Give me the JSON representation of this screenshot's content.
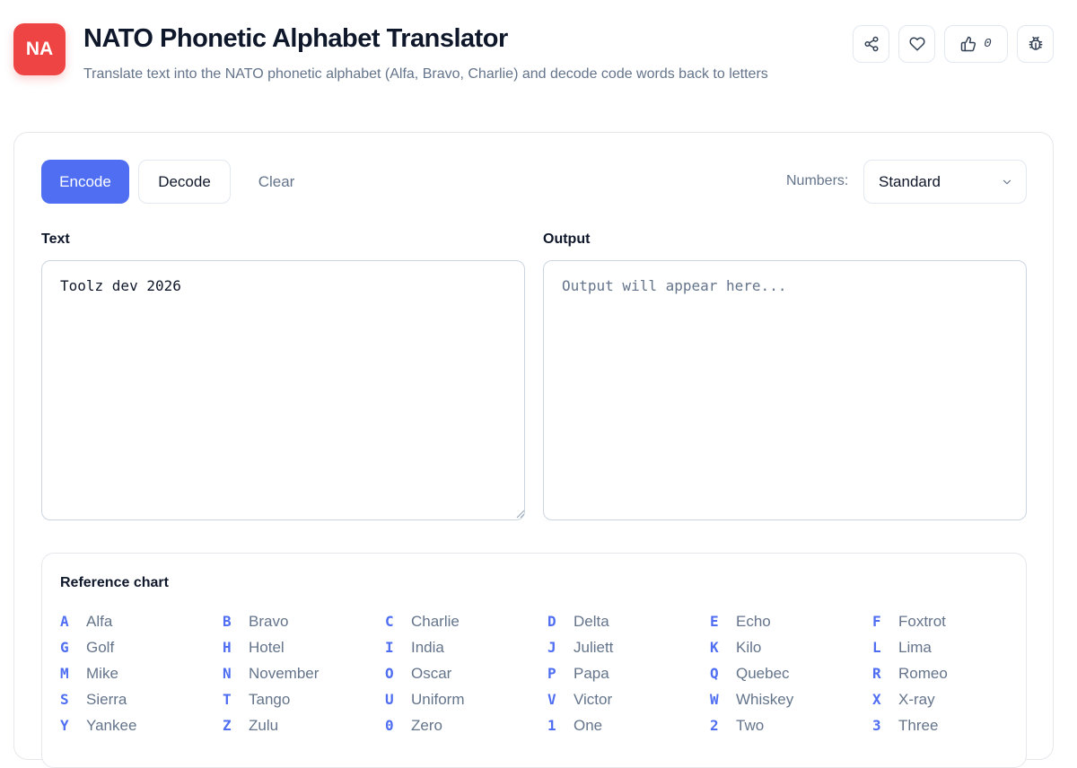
{
  "app": {
    "logo_text": "NA",
    "title": "NATO Phonetic Alphabet Translator",
    "subtitle": "Translate text into the NATO phonetic alphabet (Alfa, Bravo, Charlie) and decode code words back to letters"
  },
  "header_actions": {
    "like_count": "0"
  },
  "toolbar": {
    "encode_label": "Encode",
    "decode_label": "Decode",
    "clear_label": "Clear",
    "numbers_label": "Numbers:",
    "numbers_value": "Standard"
  },
  "input": {
    "label": "Text",
    "value": "Toolz dev 2026"
  },
  "output": {
    "label": "Output",
    "placeholder": "Output will appear here..."
  },
  "reference": {
    "title": "Reference chart",
    "entries": [
      {
        "k": "A",
        "w": "Alfa"
      },
      {
        "k": "B",
        "w": "Bravo"
      },
      {
        "k": "C",
        "w": "Charlie"
      },
      {
        "k": "D",
        "w": "Delta"
      },
      {
        "k": "E",
        "w": "Echo"
      },
      {
        "k": "F",
        "w": "Foxtrot"
      },
      {
        "k": "G",
        "w": "Golf"
      },
      {
        "k": "H",
        "w": "Hotel"
      },
      {
        "k": "I",
        "w": "India"
      },
      {
        "k": "J",
        "w": "Juliett"
      },
      {
        "k": "K",
        "w": "Kilo"
      },
      {
        "k": "L",
        "w": "Lima"
      },
      {
        "k": "M",
        "w": "Mike"
      },
      {
        "k": "N",
        "w": "November"
      },
      {
        "k": "O",
        "w": "Oscar"
      },
      {
        "k": "P",
        "w": "Papa"
      },
      {
        "k": "Q",
        "w": "Quebec"
      },
      {
        "k": "R",
        "w": "Romeo"
      },
      {
        "k": "S",
        "w": "Sierra"
      },
      {
        "k": "T",
        "w": "Tango"
      },
      {
        "k": "U",
        "w": "Uniform"
      },
      {
        "k": "V",
        "w": "Victor"
      },
      {
        "k": "W",
        "w": "Whiskey"
      },
      {
        "k": "X",
        "w": "X-ray"
      },
      {
        "k": "Y",
        "w": "Yankee"
      },
      {
        "k": "Z",
        "w": "Zulu"
      },
      {
        "k": "0",
        "w": "Zero"
      },
      {
        "k": "1",
        "w": "One"
      },
      {
        "k": "2",
        "w": "Two"
      },
      {
        "k": "3",
        "w": "Three"
      }
    ]
  },
  "colors": {
    "accent": "#4f6ef2",
    "logo_bg": "#ef4444",
    "muted_text": "#64748b",
    "border": "#e2e8f0"
  }
}
